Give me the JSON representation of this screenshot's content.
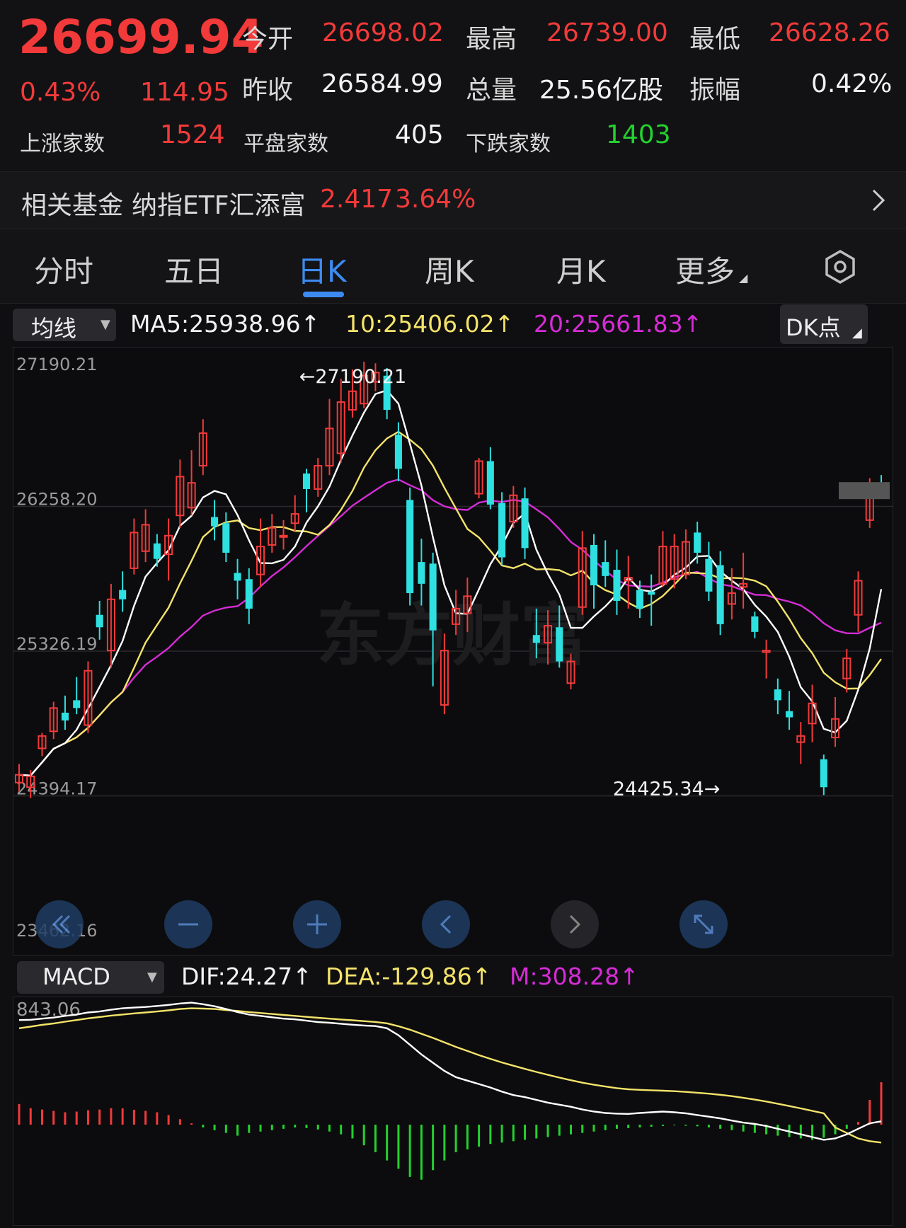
{
  "quote": {
    "price": "26699.94",
    "change_pct": "0.43%",
    "change_pts": "114.95",
    "open_label": "今开",
    "open": "26698.02",
    "high_label": "最高",
    "high": "26739.00",
    "low_label": "最低",
    "low": "26628.26",
    "prev_close_label": "昨收",
    "prev_close": "26584.99",
    "volume_label": "总量",
    "volume": "25.56亿股",
    "amplitude_label": "振幅",
    "amplitude": "0.42%",
    "up_count_label": "上涨家数",
    "up_count": "1524",
    "flat_count_label": "平盘家数",
    "flat_count": "405",
    "down_count_label": "下跌家数",
    "down_count": "1403"
  },
  "fund": {
    "label": "相关基金",
    "name": "纳指ETF汇添富",
    "price": "2.417",
    "change_pct": "3.64%"
  },
  "tabs": [
    {
      "label": "分时"
    },
    {
      "label": "五日"
    },
    {
      "label": "日K"
    },
    {
      "label": "周K"
    },
    {
      "label": "月K"
    },
    {
      "label": "更多"
    }
  ],
  "active_tab": "日K",
  "indicators": {
    "ma_select": "均线",
    "ma5": "MA5:25938.96↑",
    "ma10": "10:25406.02↑",
    "ma20": "20:25661.83↑",
    "dk_button": "DK点",
    "macd_select": "MACD",
    "dif": "DIF:24.27↑",
    "dea": "DEA:-129.86↑",
    "m": "M:308.28↑"
  },
  "colors": {
    "up": "#f23a3a",
    "down": "#2ee0e0",
    "ma5": "#ffffff",
    "ma10": "#f4e36a",
    "ma20": "#d62cd6",
    "macd_pos": "#f23a3a",
    "macd_neg": "#23d12f",
    "accent": "#3d8bf0"
  },
  "icons": {
    "settings": "gear-icon",
    "fund_arrow": "chevron-right-icon",
    "fast_back": "double-chevron-left-icon",
    "zoom_out": "minus-icon",
    "zoom_in": "plus-icon",
    "prev": "chevron-left-icon",
    "next": "chevron-right-icon",
    "fullscreen": "expand-icon"
  },
  "chart_data": [
    {
      "type": "candlestick",
      "ylim": [
        23462.16,
        27190.21
      ],
      "ytick_labels": [
        "27190.21",
        "26258.20",
        "25326.19",
        "24394.17",
        "23462.16"
      ],
      "yticks": [
        27190.21,
        26258.2,
        25326.19,
        24394.17,
        23462.16
      ],
      "annotations": [
        {
          "text": "←27190.21",
          "value": 27190.21,
          "index": 24
        },
        {
          "text": "24425.34→",
          "value": 24425.34,
          "index": 62
        }
      ],
      "watermark": "东方财富",
      "candles": [
        [
          24480,
          24530,
          24420,
          24600
        ],
        [
          24450,
          24520,
          24380,
          24560
        ],
        [
          24700,
          24780,
          24650,
          24800
        ],
        [
          24810,
          24960,
          24760,
          25000
        ],
        [
          24930,
          24880,
          24820,
          25040
        ],
        [
          25010,
          24960,
          24920,
          25160
        ],
        [
          24850,
          25200,
          24800,
          25260
        ],
        [
          25560,
          25480,
          25400,
          25650
        ],
        [
          25330,
          25660,
          25220,
          25760
        ],
        [
          25720,
          25660,
          25580,
          25840
        ],
        [
          25860,
          26090,
          25820,
          26180
        ],
        [
          25970,
          26140,
          25900,
          26240
        ],
        [
          26020,
          25920,
          25870,
          26080
        ],
        [
          25950,
          26070,
          25780,
          26180
        ],
        [
          26200,
          26450,
          26120,
          26560
        ],
        [
          26250,
          26410,
          26200,
          26620
        ],
        [
          26520,
          26730,
          26460,
          26820
        ],
        [
          26190,
          26130,
          26040,
          26300
        ],
        [
          26150,
          25960,
          25900,
          26220
        ],
        [
          25830,
          25780,
          25660,
          25920
        ],
        [
          25790,
          25600,
          25500,
          25860
        ],
        [
          25820,
          26000,
          25740,
          26180
        ],
        [
          26010,
          26120,
          25960,
          26210
        ],
        [
          26070,
          26070,
          25980,
          26170
        ],
        [
          26150,
          26210,
          26100,
          26330
        ],
        [
          26470,
          26370,
          26220,
          26500
        ],
        [
          26370,
          26520,
          26320,
          26570
        ],
        [
          26520,
          26760,
          26460,
          26950
        ],
        [
          26600,
          26930,
          26540,
          27080
        ],
        [
          26880,
          27000,
          26830,
          27140
        ],
        [
          26920,
          27100,
          26890,
          27190
        ],
        [
          27060,
          27120,
          27000,
          27180
        ],
        [
          27100,
          26880,
          26820,
          27150
        ],
        [
          26720,
          26500,
          26420,
          26800
        ],
        [
          26300,
          25700,
          25620,
          26380
        ],
        [
          25900,
          25760,
          25620,
          26050
        ],
        [
          25890,
          25460,
          25100,
          25960
        ],
        [
          24980,
          25330,
          24920,
          25440
        ],
        [
          25500,
          25600,
          25430,
          25720
        ],
        [
          25570,
          25680,
          25450,
          25800
        ],
        [
          26340,
          26550,
          26310,
          26570
        ],
        [
          26550,
          26270,
          26240,
          26640
        ],
        [
          26280,
          25930,
          25880,
          26350
        ],
        [
          26160,
          26330,
          26120,
          26390
        ],
        [
          26310,
          25990,
          25920,
          26380
        ],
        [
          25430,
          25380,
          25280,
          25600
        ],
        [
          25380,
          25490,
          25240,
          25590
        ],
        [
          25480,
          25260,
          25220,
          25620
        ],
        [
          25120,
          25260,
          25080,
          25310
        ],
        [
          25610,
          25990,
          25560,
          26100
        ],
        [
          26010,
          25750,
          25600,
          26080
        ],
        [
          25900,
          25810,
          25740,
          26040
        ],
        [
          25850,
          25650,
          25560,
          25980
        ],
        [
          25780,
          25800,
          25600,
          25940
        ],
        [
          25720,
          25600,
          25540,
          25780
        ],
        [
          25710,
          25690,
          25490,
          25820
        ],
        [
          25760,
          26000,
          25740,
          26100
        ],
        [
          25790,
          26000,
          25730,
          26080
        ],
        [
          25820,
          26030,
          25790,
          26110
        ],
        [
          26090,
          25960,
          25890,
          26160
        ],
        [
          25920,
          25710,
          25650,
          26030
        ],
        [
          25880,
          25500,
          25430,
          25970
        ],
        [
          25630,
          25700,
          25530,
          25860
        ],
        [
          25740,
          25760,
          25600,
          25960
        ],
        [
          25550,
          25450,
          25410,
          25580
        ],
        [
          25320,
          25330,
          25150,
          25400
        ],
        [
          25080,
          25010,
          24920,
          25150
        ],
        [
          24940,
          24900,
          24820,
          25070
        ],
        [
          24740,
          24780,
          24600,
          24870
        ],
        [
          24860,
          24990,
          24740,
          25110
        ],
        [
          24630,
          24450,
          24400,
          24660
        ],
        [
          24770,
          24890,
          24710,
          25030
        ],
        [
          25150,
          25280,
          25060,
          25340
        ],
        [
          25560,
          25780,
          25450,
          25840
        ],
        [
          26170,
          26320,
          26120,
          26440
        ],
        [
          26390,
          26360,
          26310,
          26460
        ]
      ]
    },
    {
      "type": "macd",
      "ylabel_top": "843.06",
      "top_value": 843.06,
      "dif": [
        760,
        762,
        770,
        778,
        790,
        800,
        815,
        822,
        835,
        845,
        850,
        855,
        862,
        870,
        880,
        886,
        875,
        860,
        840,
        818,
        800,
        790,
        780,
        770,
        765,
        755,
        745,
        740,
        733,
        726,
        720,
        716,
        700,
        650,
        580,
        510,
        450,
        390,
        345,
        320,
        295,
        270,
        240,
        215,
        200,
        180,
        160,
        145,
        130,
        110,
        95,
        85,
        80,
        78,
        85,
        90,
        95,
        90,
        82,
        70,
        58,
        46,
        30,
        15,
        5,
        -10,
        -30,
        -50,
        -70,
        -90,
        -110,
        -100,
        -70,
        -30,
        10,
        24
      ],
      "dea": [
        700,
        712,
        725,
        735,
        748,
        760,
        772,
        782,
        792,
        800,
        808,
        815,
        822,
        830,
        840,
        845,
        843,
        840,
        833,
        826,
        818,
        811,
        804,
        797,
        790,
        783,
        776,
        770,
        764,
        758,
        752,
        746,
        736,
        715,
        690,
        660,
        630,
        598,
        565,
        535,
        505,
        478,
        452,
        428,
        405,
        383,
        362,
        342,
        323,
        305,
        290,
        277,
        265,
        257,
        253,
        250,
        247,
        243,
        238,
        232,
        225,
        217,
        207,
        195,
        182,
        168,
        152,
        135,
        118,
        100,
        82,
        -20,
        -60,
        -100,
        -120,
        -129.86
      ],
      "m": [
        150,
        120,
        110,
        100,
        90,
        95,
        105,
        110,
        120,
        118,
        108,
        100,
        90,
        70,
        40,
        10,
        -20,
        -40,
        -60,
        -80,
        -60,
        -50,
        -40,
        -30,
        -20,
        -25,
        -35,
        -50,
        -70,
        -100,
        -150,
        -200,
        -260,
        -320,
        -380,
        -400,
        -330,
        -260,
        -200,
        -180,
        -160,
        -140,
        -130,
        -120,
        -110,
        -100,
        -90,
        -80,
        -70,
        -60,
        -50,
        -40,
        -30,
        -25,
        -20,
        -15,
        -10,
        -5,
        -8,
        -12,
        -20,
        -30,
        -40,
        -50,
        -60,
        -70,
        -80,
        -90,
        -100,
        -110,
        -95,
        -70,
        -30,
        20,
        180,
        308.28
      ]
    }
  ]
}
